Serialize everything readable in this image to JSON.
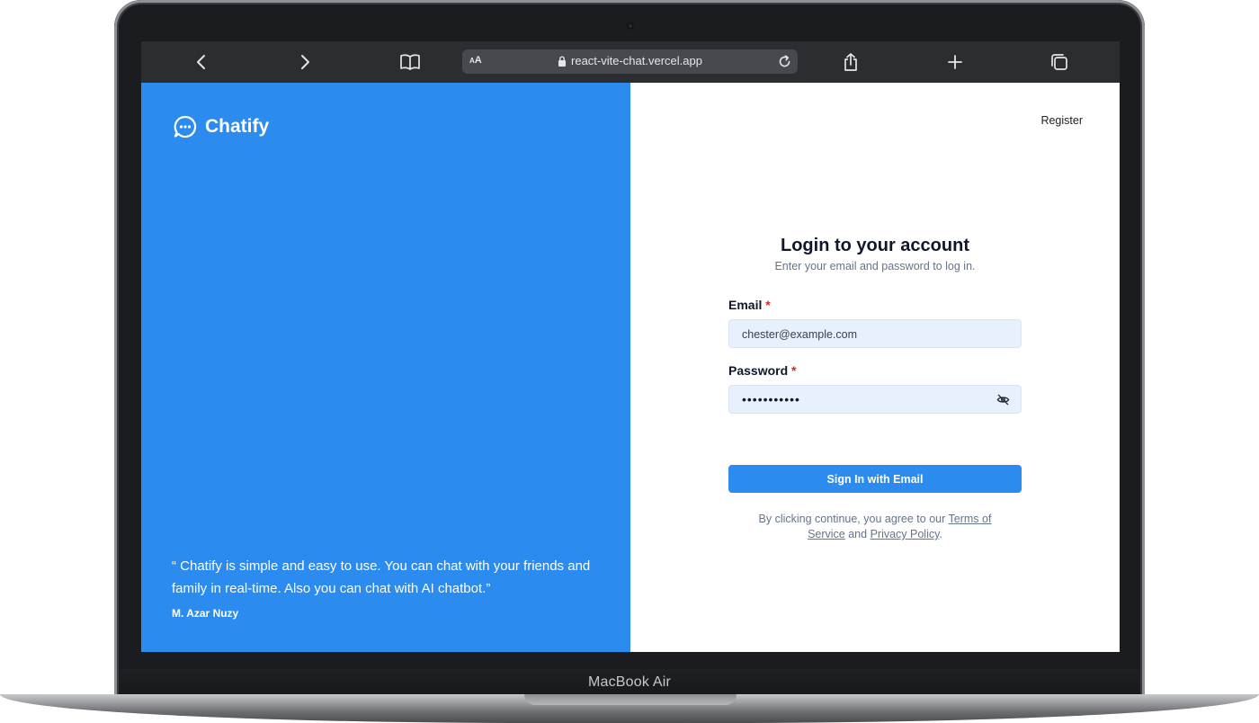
{
  "device": {
    "label": "MacBook Air"
  },
  "browser": {
    "url": "react-vite-chat.vercel.app",
    "aa_label": "AA",
    "icons": {
      "back": "chevron-left-icon",
      "forward": "chevron-right-icon",
      "bookmarks": "book-icon",
      "lock": "lock-icon",
      "reload": "reload-icon",
      "share": "share-icon",
      "new_tab": "plus-icon",
      "tabs": "tabs-icon"
    }
  },
  "brand": {
    "name": "Chatify",
    "icon": "chat-bubble-icon",
    "color": "#2b8bef"
  },
  "testimonial": {
    "quote": "“ Chatify is simple and easy to use. You can chat with your friends and family in real-time. Also you can chat with AI chatbot.”",
    "author": "M. Azar Nuzy"
  },
  "nav": {
    "register": "Register"
  },
  "login": {
    "title": "Login to your account",
    "subtitle": "Enter your email and password to log in.",
    "email_label": "Email",
    "email_value": "chester@example.com",
    "password_label": "Password",
    "password_value": "•••••••••••",
    "required_mark": "*",
    "submit": "Sign In with Email",
    "terms_prefix": "By clicking continue, you agree to our ",
    "terms_link_a": "Terms of",
    "terms_link_b": "Service",
    "terms_and": " and ",
    "privacy_link": "Privacy Policy",
    "terms_suffix": "."
  }
}
